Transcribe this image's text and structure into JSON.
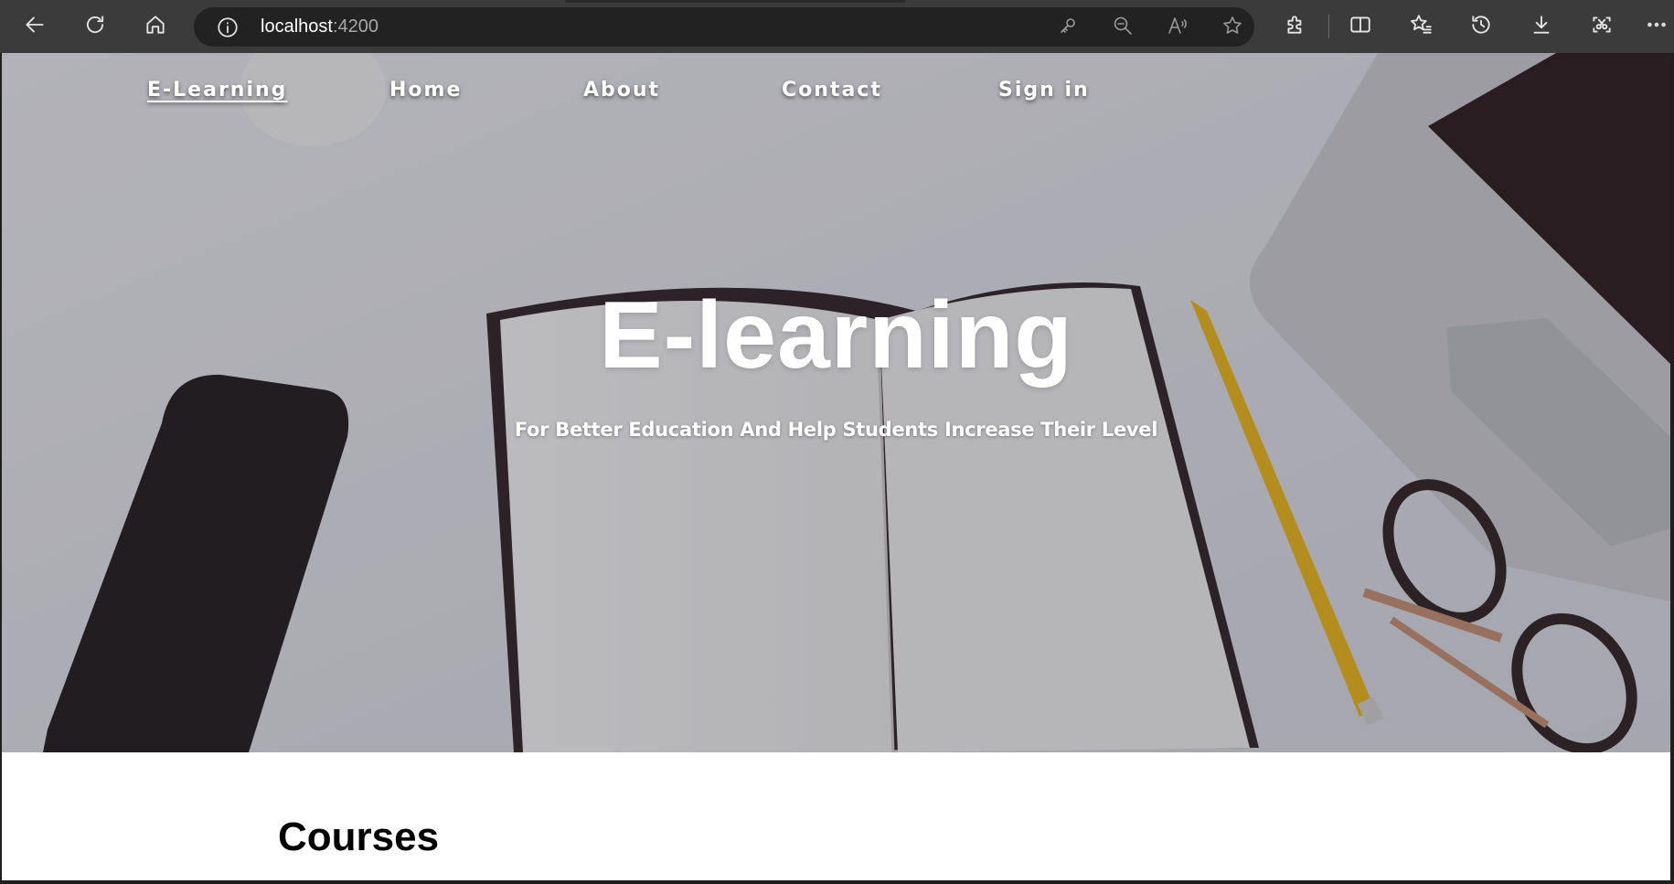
{
  "browser": {
    "url_host": "localhost",
    "url_port": ":4200",
    "icons": {
      "back": "arrow-left-icon",
      "refresh": "refresh-icon",
      "home": "home-icon",
      "site_info": "info-icon",
      "password": "key-icon",
      "zoom": "zoom-out-icon",
      "read_aloud": "read-aloud-icon",
      "favorite": "star-icon",
      "extensions": "puzzle-icon",
      "split_screen": "split-screen-icon",
      "favorites": "favorites-icon",
      "history": "history-icon",
      "downloads": "download-icon",
      "screenshot": "screenshot-icon",
      "more": "more-icon"
    }
  },
  "nav": {
    "brand": "E-Learning",
    "items": [
      "Home",
      "About",
      "Contact",
      "Sign in"
    ]
  },
  "hero": {
    "title": "E-learning",
    "subtitle": "For Better Education And Help Students Increase Their Level"
  },
  "courses": {
    "heading": "Courses"
  },
  "colors": {
    "toolbar": "#3b3b3b",
    "address_bar": "#222222",
    "hero_text": "#ffffff",
    "heading_text": "#000000"
  }
}
